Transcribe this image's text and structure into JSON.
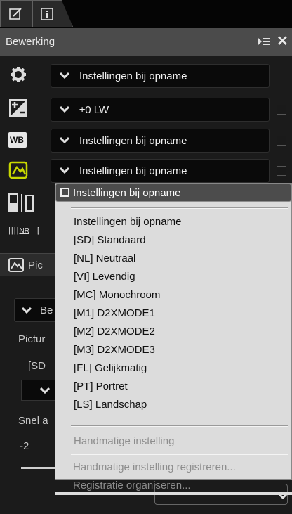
{
  "tabs": [
    {
      "icon": "edit-icon"
    },
    {
      "icon": "info-icon"
    }
  ],
  "panel": {
    "title": "Bewerking",
    "menu_icon": "panel-menu-icon",
    "close_icon": "close-icon",
    "close_symbol": "✕"
  },
  "rows": [
    {
      "icon": "settings-gear-icon",
      "value": "Instellingen bij opname",
      "checkbox": false
    },
    {
      "icon": "exposure-compensation-icon",
      "value": "±0 LW",
      "checkbox": true
    },
    {
      "icon": "white-balance-icon",
      "icon_text": "WB",
      "value": "Instellingen bij opname",
      "checkbox": true
    },
    {
      "icon": "picture-control-icon",
      "value": "Instellingen bij opname",
      "checkbox": true
    }
  ],
  "lower": {
    "section_title": "Pic",
    "dropdown_value": "Be",
    "label1": "Pictur",
    "label2": "[SD",
    "snel_label": "Snel a",
    "slider_min": "-2",
    "nr_icon_text": "NR"
  },
  "popup": {
    "current": "Instellingen bij opname",
    "items": [
      "Instellingen bij opname",
      "[SD] Standaard",
      "[NL] Neutraal",
      "[VI] Levendig",
      "[MC] Monochroom",
      "[M1] D2XMODE1",
      "[M2] D2XMODE2",
      "[M3] D2XMODE3",
      "[FL] Gelijkmatig",
      "[PT] Portret",
      "[LS] Landschap"
    ],
    "manual": "Handmatige instelling",
    "register": "Handmatige instelling registreren...",
    "organize": "Registratie organiseren..."
  },
  "colors": {
    "panel_bg": "#1b1b1b",
    "header_bg": "#4b4b4b",
    "popup_bg": "#dcdcdc",
    "picture_control_accent": "#c8d800"
  }
}
